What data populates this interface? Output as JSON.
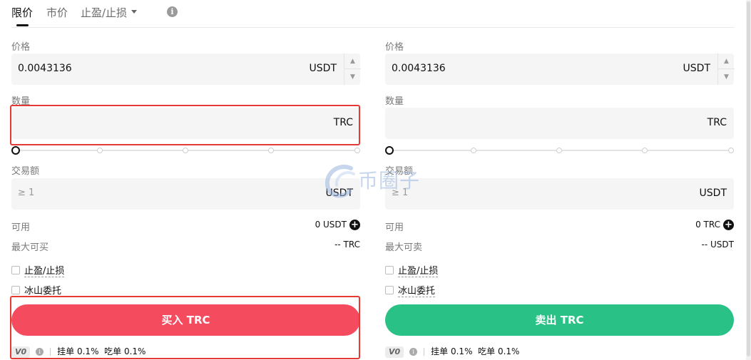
{
  "tabs": {
    "limit": "限价",
    "market": "市价",
    "tpsl": "止盈/止损"
  },
  "buy": {
    "price_label": "价格",
    "price_value": "0.0043136",
    "price_unit": "USDT",
    "qty_label": "数量",
    "qty_unit": "TRC",
    "amount_label": "交易额",
    "amount_placeholder": "≥ 1",
    "amount_unit": "USDT",
    "available_label": "可用",
    "available_value": "0 USDT",
    "max_label": "最大可买",
    "max_value": "-- TRC",
    "tpsl_label": "止盈/止损",
    "iceberg_label": "冰山委托",
    "button_label": "买入 TRC",
    "vip": "V0",
    "maker_fee": "挂单 0.1%",
    "taker_fee": "吃单 0.1%",
    "slider_percent": 0
  },
  "sell": {
    "price_label": "价格",
    "price_value": "0.0043136",
    "price_unit": "USDT",
    "qty_label": "数量",
    "qty_unit": "TRC",
    "amount_label": "交易额",
    "amount_placeholder": "≥ 1",
    "amount_unit": "USDT",
    "available_label": "可用",
    "available_value": "0 TRC",
    "max_label": "最大可卖",
    "max_value": "-- USDT",
    "tpsl_label": "止盈/止损",
    "iceberg_label": "冰山委托",
    "button_label": "卖出 TRC",
    "vip": "V0",
    "maker_fee": "挂单 0.1%",
    "taker_fee": "吃单 0.1%",
    "slider_percent": 0
  },
  "watermark": "币圈子",
  "colors": {
    "buy": "#f54b5f",
    "sell": "#29c185",
    "highlight": "#e53935"
  },
  "icons": [
    "info-icon",
    "caret-down-icon",
    "chevron-up-icon",
    "chevron-down-icon",
    "plus-circle-icon"
  ]
}
